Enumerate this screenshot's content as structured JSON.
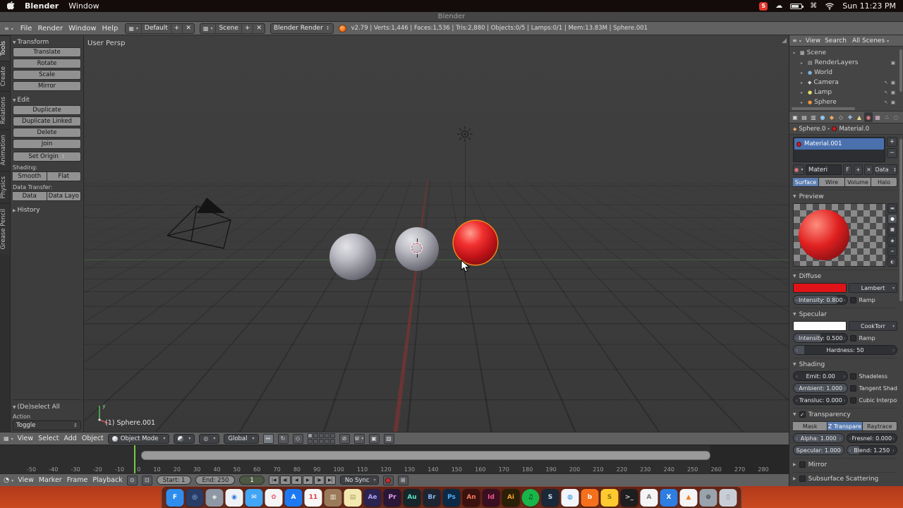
{
  "menubar": {
    "app_name": "Blender",
    "window_menu": "Window",
    "spotify_badge": "S",
    "clock": "Sun 11:23 PM"
  },
  "window": {
    "title": "Blender"
  },
  "topbar": {
    "menus": [
      {
        "label": "File",
        "dn": "menu-file"
      },
      {
        "label": "Render",
        "dn": "menu-render"
      },
      {
        "label": "Window",
        "dn": "menu-window"
      },
      {
        "label": "Help",
        "dn": "menu-help"
      }
    ],
    "layout": "Default",
    "scene": "Scene",
    "engine": "Blender Render",
    "stats": "v2.79 | Verts:1,446 | Faces:1,536 | Tris:2,880 | Objects:0/5 | Lamps:0/1 | Mem:13.83M | Sphere.001"
  },
  "toolshelf": {
    "tabs": [
      {
        "label": "Tools",
        "dn": "shelf-tab-tools",
        "active": true
      },
      {
        "label": "Create",
        "dn": "shelf-tab-create"
      },
      {
        "label": "Relations",
        "dn": "shelf-tab-relations"
      },
      {
        "label": "Animation",
        "dn": "shelf-tab-animation"
      },
      {
        "label": "Physics",
        "dn": "shelf-tab-physics"
      },
      {
        "label": "Grease Pencil",
        "dn": "shelf-tab-grease-pencil"
      }
    ],
    "transform_title": "Transform",
    "transform_buttons": [
      {
        "label": "Translate",
        "dn": "translate-button"
      },
      {
        "label": "Rotate",
        "dn": "rotate-button"
      },
      {
        "label": "Scale",
        "dn": "scale-button"
      },
      {
        "label": "Mirror",
        "dn": "mirror-button"
      }
    ],
    "edit_title": "Edit",
    "edit_buttons": [
      {
        "label": "Duplicate",
        "dn": "duplicate-button"
      },
      {
        "label": "Duplicate Linked",
        "dn": "duplicate-linked-button"
      },
      {
        "label": "Delete",
        "dn": "delete-button"
      },
      {
        "label": "Join",
        "dn": "join-button"
      }
    ],
    "set_origin": "Set Origin",
    "shading_label": "Shading:",
    "shading_buttons": [
      {
        "label": "Smooth",
        "dn": "smooth-button"
      },
      {
        "label": "Flat",
        "dn": "flat-button"
      }
    ],
    "data_transfer_label": "Data Transfer:",
    "data_buttons": [
      {
        "label": "Data",
        "dn": "data-button"
      },
      {
        "label": "Data Layo",
        "dn": "data-layout-button"
      }
    ],
    "history_title": "History",
    "operator_title": "(De)select All",
    "action_label": "Action",
    "action_value": "Toggle"
  },
  "viewport": {
    "view_label": "User Persp",
    "object_label": "(1) Sphere.001",
    "axis_y": "y"
  },
  "vp_header": {
    "menus": [
      {
        "label": "View",
        "dn": "viewport-menu-view"
      },
      {
        "label": "Select",
        "dn": "viewport-menu-select"
      },
      {
        "label": "Add",
        "dn": "viewport-menu-add"
      },
      {
        "label": "Object",
        "dn": "viewport-menu-object"
      }
    ],
    "mode": "Object Mode",
    "orientation": "Global"
  },
  "outliner": {
    "view_menu": "View",
    "search_menu": "Search",
    "filter": "All Scenes",
    "items": [
      {
        "label": "Scene",
        "dn": "outliner-item-scene",
        "chev": "▾",
        "g": "▦",
        "style": "padding-left:3px",
        "gstyle": "color:#cfcfcf",
        "right": ""
      },
      {
        "label": "RenderLayers",
        "dn": "outliner-item-renderlayers",
        "chev": "▸",
        "g": "▤",
        "style": "padding-left:14px",
        "gstyle": "color:#b9c6d2",
        "right": "▣"
      },
      {
        "label": "World",
        "dn": "outliner-item-world",
        "chev": "▸",
        "g": "●",
        "style": "padding-left:14px",
        "gstyle": "color:#7fb5e0",
        "right": ""
      },
      {
        "label": "Camera",
        "dn": "outliner-item-camera",
        "chev": "▸",
        "g": "◆",
        "style": "padding-left:14px",
        "gstyle": "color:#d8d8d8",
        "right": "↖ ▣"
      },
      {
        "label": "Lamp",
        "dn": "outliner-item-lamp",
        "chev": "▸",
        "g": "●",
        "style": "padding-left:14px",
        "gstyle": "color:#e8dc72",
        "right": "↖ ▣"
      },
      {
        "label": "Sphere",
        "dn": "outliner-item-sphere",
        "chev": "▸",
        "g": "●",
        "style": "padding-left:14px",
        "gstyle": "color:#f2953f",
        "right": "↖ ▣"
      }
    ]
  },
  "properties": {
    "tabs": [
      {
        "dn": "props-tab-render",
        "g": "▣",
        "style": "color:#d8d8d8"
      },
      {
        "dn": "props-tab-render-layers",
        "g": "▤",
        "style": "color:#d8d8d8"
      },
      {
        "dn": "props-tab-scene",
        "g": "▥",
        "style": "color:#d8d8d8"
      },
      {
        "dn": "props-tab-world",
        "g": "●",
        "style": "color:#8fc3ea"
      },
      {
        "dn": "props-tab-object",
        "g": "◆",
        "style": "color:#f0a860"
      },
      {
        "dn": "props-tab-constraints",
        "g": "◇",
        "style": "color:#c8c8c8"
      },
      {
        "dn": "props-tab-modifiers",
        "g": "✚",
        "style": "color:#9fc4e8"
      },
      {
        "dn": "props-tab-object-data",
        "g": "▲",
        "style": "color:#e8d890"
      },
      {
        "dn": "props-tab-material",
        "g": "◉",
        "style": "color:#f08080",
        "active": true
      },
      {
        "dn": "props-tab-texture",
        "g": "▦",
        "style": "color:#d8b8c8"
      },
      {
        "dn": "props-tab-particles",
        "g": "∴",
        "style": "color:#d8d8d8"
      },
      {
        "dn": "props-tab-physics",
        "g": "◌",
        "style": "color:#9fd0e8"
      }
    ],
    "breadcrumb_object": "Sphere.0",
    "breadcrumb_material": "Material.0",
    "slot_name": "Material.001",
    "slot_add": "+",
    "slot_remove": "−",
    "name_value": "Materi",
    "fake_user": "F",
    "add_user": "+",
    "unlink": "✕",
    "datablock": "Data",
    "type_buttons": [
      {
        "label": "Surface",
        "dn": "material-type-surface",
        "active": true
      },
      {
        "label": "Wire",
        "dn": "material-type-wire"
      },
      {
        "label": "Volume",
        "dn": "material-type-volume"
      },
      {
        "label": "Halo",
        "dn": "material-type-halo"
      }
    ],
    "preview_title": "Preview",
    "preview_icons": [
      {
        "g": "▬",
        "dn": "preview-flat-icon"
      },
      {
        "g": "●",
        "dn": "preview-sphere-icon",
        "active": true
      },
      {
        "g": "■",
        "dn": "preview-cube-icon"
      },
      {
        "g": "◆",
        "dn": "preview-monkey-icon"
      },
      {
        "g": "≈",
        "dn": "preview-hair-icon"
      },
      {
        "g": "◐",
        "dn": "preview-world-icon"
      }
    ],
    "diffuse": {
      "title": "Diffuse",
      "color": "#df1318",
      "shader": "Lambert",
      "intensity": "Intensity: 0.800",
      "intensity_pct": 80,
      "ramp": "Ramp"
    },
    "specular": {
      "title": "Specular",
      "color": "#ffffff",
      "shader": "CookTorr",
      "intensity": "Intensity: 0.500",
      "intensity_pct": 50,
      "ramp": "Ramp",
      "hardness": "Hardness: 50",
      "hardness_pct": 10
    },
    "shading_title": "Shading",
    "shading_rows": [
      {
        "field": "Emit: 0.00",
        "pct": 0,
        "check": "Shadeless",
        "fdn": "emit-field",
        "cdn": "shadeless-checkbox"
      },
      {
        "field": "Ambient: 1.000",
        "pct": 100,
        "check": "Tangent Shad",
        "fdn": "ambient-field",
        "cdn": "tangent-shading-checkbox"
      },
      {
        "field": "Transluc: 0.000",
        "pct": 0,
        "check": "Cubic Interpol",
        "fdn": "translucency-field",
        "cdn": "cubic-interpolation-checkbox"
      }
    ],
    "transparency": {
      "title": "Transparency",
      "modes": [
        {
          "label": "Mask",
          "dn": "transparency-mask-button"
        },
        {
          "label": "Z Transpare",
          "dn": "transparency-ztransparency-button",
          "active": true
        },
        {
          "label": "Raytrace",
          "dn": "transparency-raytrace-button"
        }
      ],
      "rows": [
        {
          "a": "Alpha: 1.000",
          "pa": 100,
          "b": "Fresnel: 0.000",
          "pb": 0,
          "adn": "alpha-slider",
          "bdn": "fresnel-slider"
        },
        {
          "a": "Specular: 1.000",
          "pa": 100,
          "b": "Blend: 1.250",
          "pb": 25,
          "adn": "specular-alpha-slider",
          "bdn": "fresnel-blend-slider"
        }
      ]
    },
    "mirror_title": "Mirror",
    "sss_title": "Subsurface Scattering"
  },
  "timeline": {
    "ticks": [
      "-50",
      "-40",
      "-30",
      "-20",
      "-10",
      "0",
      "10",
      "20",
      "30",
      "40",
      "50",
      "60",
      "70",
      "80",
      "90",
      "100",
      "110",
      "120",
      "130",
      "140",
      "150",
      "160",
      "170",
      "180",
      "190",
      "200",
      "210",
      "220",
      "230",
      "240",
      "250",
      "260",
      "270",
      "280"
    ],
    "menus": [
      {
        "label": "View",
        "dn": "timeline-menu-view"
      },
      {
        "label": "Marker",
        "dn": "timeline-menu-marker"
      },
      {
        "label": "Frame",
        "dn": "timeline-menu-frame"
      },
      {
        "label": "Playback",
        "dn": "timeline-menu-playback"
      }
    ],
    "start": "Start: 1",
    "end": "End: 250",
    "frame": "1",
    "sync": "No Sync",
    "transport": [
      {
        "g": "|◀",
        "dn": "jump-to-start-button"
      },
      {
        "g": "◀|",
        "dn": "previous-keyframe-button"
      },
      {
        "g": "◀",
        "dn": "play-reverse-button"
      },
      {
        "g": "▶",
        "dn": "play-button"
      },
      {
        "g": "|▶",
        "dn": "next-keyframe-button"
      },
      {
        "g": "▶|",
        "dn": "jump-to-end-button"
      }
    ]
  },
  "dock": {
    "icons": [
      {
        "dn": "dock-icon-finder",
        "g": "F",
        "style": "background:#2f8ded;color:#ffffff"
      },
      {
        "dn": "dock-icon-siri",
        "g": "◎",
        "style": "background:#283c66;color:#9fd4ff"
      },
      {
        "dn": "dock-icon-launchpad",
        "g": "◈",
        "style": "background:#8e98a4;color:#f2f2f2"
      },
      {
        "dn": "dock-icon-safari",
        "g": "◉",
        "style": "background:#eef2f6;color:#2f7bd9"
      },
      {
        "dn": "dock-icon-mail",
        "g": "✉",
        "style": "background:#42a5f5;color:#ffffff"
      },
      {
        "dn": "dock-icon-photos",
        "g": "✿",
        "style": "background:#f5f5f5;color:#e85d75"
      },
      {
        "dn": "dock-icon-app-store",
        "g": "A",
        "style": "background:#1d79f2;color:#ffffff"
      },
      {
        "dn": "dock-icon-calendar",
        "g": "11",
        "style": "background:#f7f7f7;color:#e04040"
      },
      {
        "dn": "dock-icon-contacts",
        "g": "▥",
        "style": "background:#9a7a5a;color:#f0e8d8"
      },
      {
        "dn": "dock-icon-notes",
        "g": "▤",
        "style": "background:#f2e9b0;color:#b0a060"
      },
      {
        "dn": "dock-icon-after-effects",
        "g": "Ae",
        "style": "background:#2b2350;color:#b0a1f5"
      },
      {
        "dn": "dock-icon-premiere",
        "g": "Pr",
        "style": "background:#2a1636;color:#e2a4f0"
      },
      {
        "dn": "dock-icon-audition",
        "g": "Au",
        "style": "background:#16262a;color:#5fe0c0"
      },
      {
        "dn": "dock-icon-bridge",
        "g": "Br",
        "style": "background:#1e2430;color:#88b8f0"
      },
      {
        "dn": "dock-icon-photoshop",
        "g": "Ps",
        "style": "background:#0c2a45;color:#53aef2"
      },
      {
        "dn": "dock-icon-animate",
        "g": "An",
        "style": "background:#3a1210;color:#f07a5a"
      },
      {
        "dn": "dock-icon-indesign",
        "g": "Id",
        "style": "background:#3a0f22;color:#f05a8a"
      },
      {
        "dn": "dock-icon-illustrator",
        "g": "Ai",
        "style": "background:#2a1f07;color:#f0a22e"
      },
      {
        "dn": "dock-icon-spotify",
        "g": "♫",
        "style": "background:#18b54a;color:#06220e;border-radius:50%"
      },
      {
        "dn": "dock-icon-steam",
        "g": "S",
        "style": "background:#1b2838;color:#cfe3f5"
      },
      {
        "dn": "dock-icon-docker",
        "g": "◍",
        "style": "background:#f2f6fa;color:#1d8fe0"
      },
      {
        "dn": "dock-icon-blender",
        "g": "b",
        "style": "background:#f5701d;color:#ffffff"
      },
      {
        "dn": "dock-icon-sketch",
        "g": "S",
        "style": "background:#fdca2f;color:#8a6d10"
      },
      {
        "dn": "dock-icon-terminal",
        "g": ">_",
        "style": "background:#1e1e1e;color:#d0d0d0"
      },
      {
        "dn": "dock-icon-textedit",
        "g": "A",
        "style": "background:#f5f5f5;color:#777777"
      },
      {
        "dn": "dock-icon-xcode",
        "g": "X",
        "style": "background:#2e7de0;color:#ffffff"
      },
      {
        "dn": "dock-icon-vlc",
        "g": "▲",
        "style": "background:#f5f5f5;color:#ef7f1a"
      },
      {
        "dn": "dock-icon-system-preferences",
        "g": "⊚",
        "style": "background:#9aa2ac;color:#3c4046"
      },
      {
        "dn": "dock-icon-trash",
        "g": "▯",
        "style": "background:#c9ced6;color:#7a8088"
      }
    ]
  }
}
